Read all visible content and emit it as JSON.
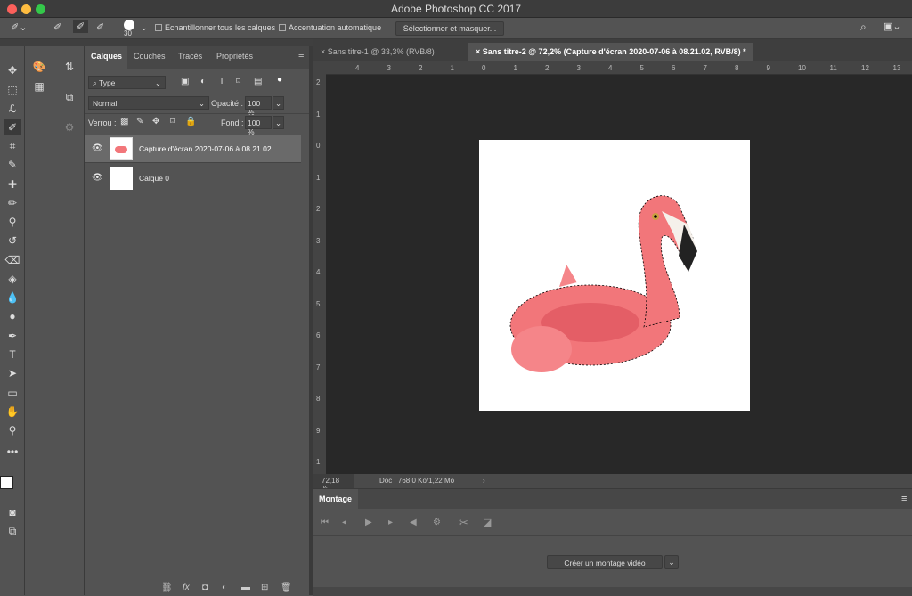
{
  "app": {
    "title": "Adobe Photoshop CC 2017"
  },
  "options": {
    "brush_size": "30",
    "sample_all_layers": "Echantillonner tous les calques",
    "auto_enhance": "Accentuation automatique",
    "select_mask_label": "Sélectionner et masquer..."
  },
  "layers_panel": {
    "tabs": [
      {
        "label": "Calques"
      },
      {
        "label": "Couches"
      },
      {
        "label": "Tracés"
      },
      {
        "label": "Propriétés"
      }
    ],
    "filter_type": "Type",
    "blend_mode": "Normal",
    "opacity_label": "Opacité :",
    "opacity_value": "100 %",
    "lock_label": "Verrou :",
    "fill_label": "Fond :",
    "fill_value": "100 %",
    "layers": [
      {
        "name": "Capture d'écran 2020-07-06 à 08.21.02",
        "selected": true,
        "visible": true
      },
      {
        "name": "Calque 0",
        "selected": false,
        "visible": true
      }
    ]
  },
  "document": {
    "tabs": [
      {
        "label": "Sans titre-1 @ 33,3% (RVB/8)",
        "active": false
      },
      {
        "label": "Sans titre-2 @ 72,2% (Capture d'écran 2020-07-06 à 08.21.02, RVB/8) *",
        "active": true
      }
    ],
    "ruler_top": [
      "4",
      "3",
      "2",
      "1",
      "0",
      "1",
      "2",
      "3",
      "4",
      "5",
      "6",
      "7",
      "8",
      "9",
      "10",
      "11",
      "12",
      "13"
    ],
    "ruler_left": [
      "2",
      "1",
      "0",
      "1",
      "2",
      "3",
      "4",
      "5",
      "6",
      "7",
      "8",
      "9",
      "1"
    ],
    "zoom": "72,18 %",
    "doc_info": "Doc : 768,0 Ko/1,22 Mo"
  },
  "montage": {
    "title": "Montage",
    "create_label": "Créer un montage vidéo"
  },
  "colors": {
    "accent_red": "#fc605b",
    "accent_yellow": "#fdbc40",
    "accent_green": "#34c84a",
    "flamingo": "#f2767a",
    "canvas": "#282828"
  }
}
